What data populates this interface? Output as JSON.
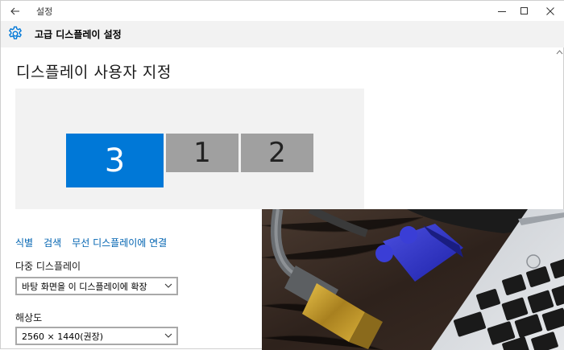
{
  "titlebar": {
    "title": "설정"
  },
  "header": {
    "title": "고급 디스플레이 설정"
  },
  "page": {
    "title": "디스플레이 사용자 지정"
  },
  "monitors": [
    {
      "label": "3",
      "selected": true
    },
    {
      "label": "1",
      "selected": false
    },
    {
      "label": "2",
      "selected": false
    }
  ],
  "links": {
    "identify": "식별",
    "detect": "검색",
    "wireless": "무선 디스플레이에 연결"
  },
  "multi_display": {
    "label": "다중 디스플레이",
    "value": "바탕 화면을 이 디스플레이에 확장"
  },
  "resolution": {
    "label": "해상도",
    "value": "2560 × 1440(권장)"
  },
  "colors": {
    "accent": "#0078d7",
    "link": "#0063b1",
    "header_bg": "#f2f2f2"
  }
}
